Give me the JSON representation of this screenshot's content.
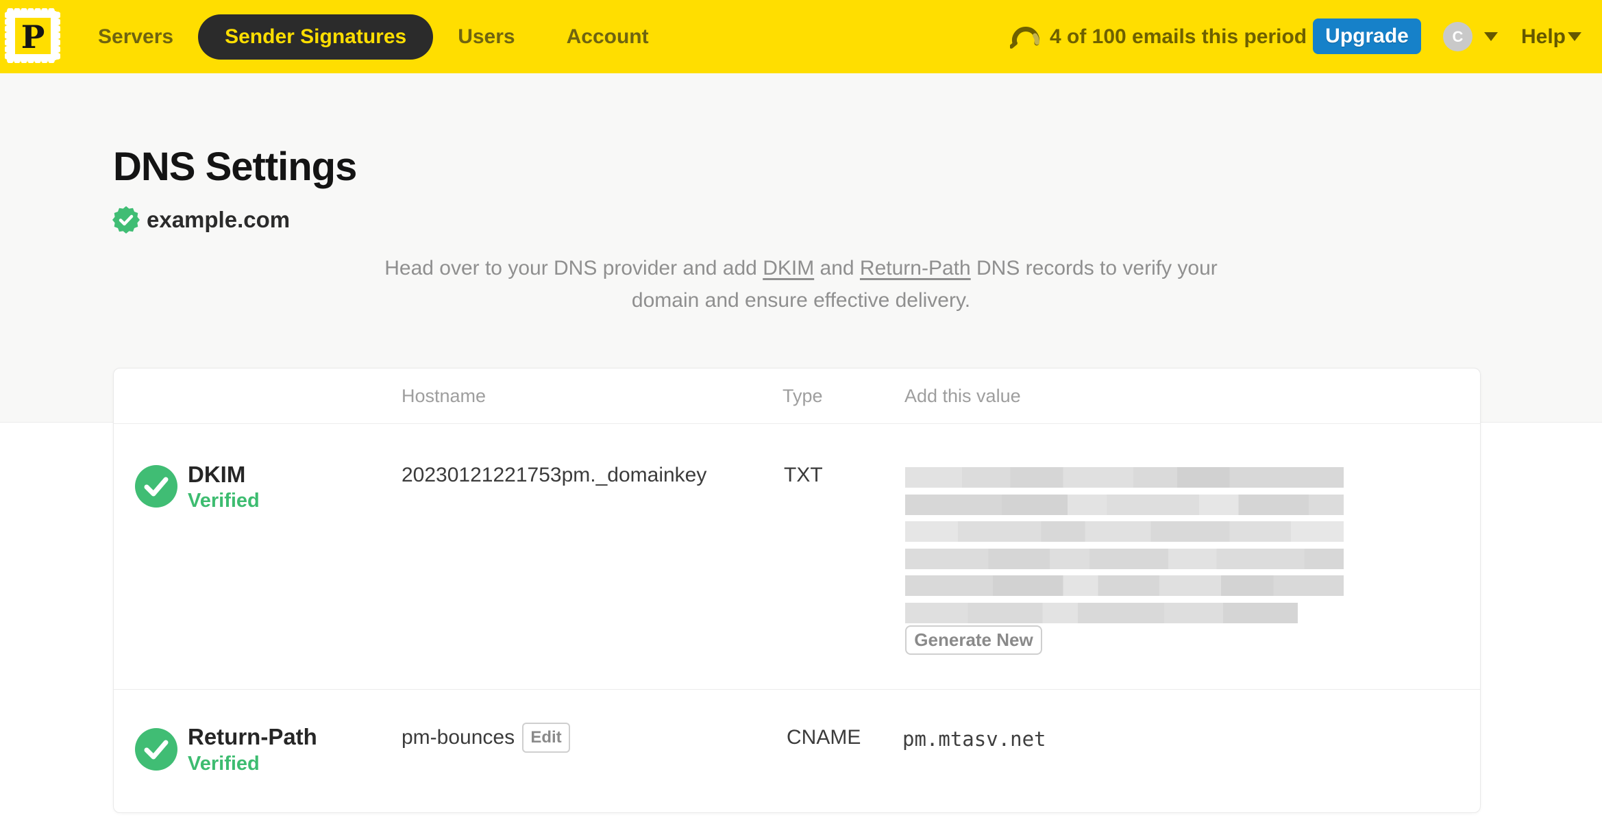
{
  "colors": {
    "brand_yellow": "#FFDE00",
    "nav_pill_dark": "#2b2b2b",
    "upgrade_blue": "#1681c9",
    "verified_green": "#40bd74"
  },
  "navbar": {
    "logo_letter": "P",
    "items": [
      {
        "label": "Servers",
        "active": false
      },
      {
        "label": "Sender Signatures",
        "active": true
      },
      {
        "label": "Users",
        "active": false
      },
      {
        "label": "Account",
        "active": false
      }
    ],
    "usage_text": "4 of 100 emails this period",
    "upgrade_label": "Upgrade",
    "avatar_initial": "C",
    "help_label": "Help"
  },
  "page": {
    "title": "DNS Settings",
    "domain": "example.com",
    "description": {
      "part1": "Head over to your DNS provider and add ",
      "link1": "DKIM",
      "part2": " and ",
      "link2": "Return-Path",
      "part3": " DNS records to verify your domain and ensure effective delivery."
    }
  },
  "table": {
    "headers": {
      "hostname": "Hostname",
      "type": "Type",
      "value": "Add this value"
    },
    "rows": [
      {
        "name": "DKIM",
        "status": "Verified",
        "hostname": "20230121221753pm._domainkey",
        "type": "TXT",
        "value_redacted": true,
        "redacted_line_widths_pct": [
          100,
          100,
          100,
          100,
          100,
          89.5
        ],
        "action": "Generate New"
      },
      {
        "name": "Return-Path",
        "status": "Verified",
        "hostname": "pm-bounces",
        "hostname_action": "Edit",
        "type": "CNAME",
        "value": "pm.mtasv.net"
      }
    ]
  }
}
